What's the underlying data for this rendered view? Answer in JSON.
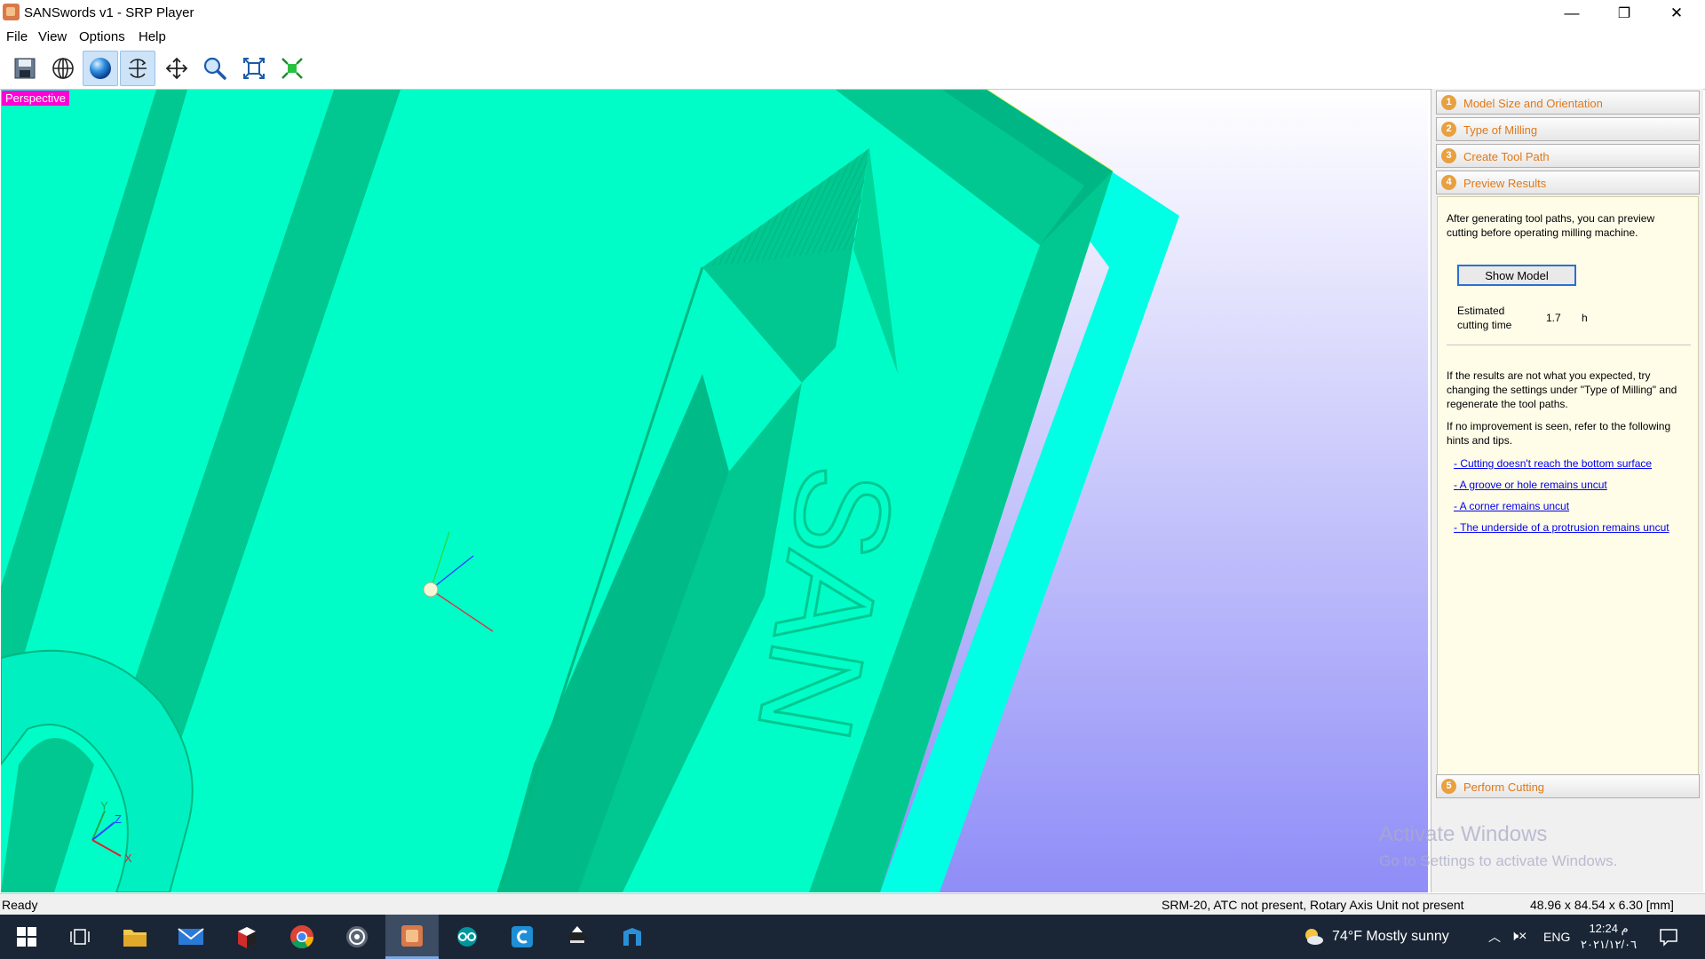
{
  "window": {
    "title": "SANSwords v1 - SRP Player",
    "minimize_glyph": "—",
    "maximize_glyph": "❐",
    "close_glyph": "✕"
  },
  "menu": [
    "File",
    "View",
    "Options",
    "Help"
  ],
  "toolbar": {
    "icons": [
      "save-icon",
      "globe-icon",
      "shaded-sphere-icon",
      "rotate-icon",
      "pan-icon",
      "zoom-icon",
      "fit-view-icon",
      "fit-all-icon"
    ],
    "active": [
      "shaded-sphere-icon",
      "rotate-icon"
    ]
  },
  "viewport": {
    "mode_label": "Perspective",
    "model_text": "SAN",
    "axes": {
      "x": "X",
      "y": "Y",
      "z": "Z"
    }
  },
  "panel": {
    "steps": [
      {
        "num": "1",
        "label": "Model Size and Orientation"
      },
      {
        "num": "2",
        "label": "Type of Milling"
      },
      {
        "num": "3",
        "label": "Create Tool Path"
      },
      {
        "num": "4",
        "label": "Preview Results"
      }
    ],
    "step5": {
      "num": "5",
      "label": "Perform Cutting"
    },
    "intro": "After generating tool paths, you can preview cutting before operating milling machine.",
    "show_model": "Show Model",
    "estimated_label": "Estimated cutting time",
    "estimated_value": "1.7",
    "estimated_unit": "h",
    "results_text": "If the results are not what you expected, try changing the settings under \"Type of Milling\" and regenerate the tool paths.",
    "improve_text": "If no improvement is seen, refer to the following hints and tips.",
    "hints": [
      "- Cutting doesn't reach the bottom surface",
      "- A groove or hole remains uncut",
      "- A corner remains uncut",
      "- The underside of a protrusion remains uncut"
    ]
  },
  "watermark": {
    "line1": "Activate Windows",
    "line2": "Go to Settings to activate Windows."
  },
  "status": {
    "left": "Ready",
    "machine": "SRM-20, ATC not present, Rotary Axis Unit not present",
    "dims": "48.96 x  84.54 x   6.30 [mm]"
  },
  "taskbar": {
    "apps": [
      "windows-start-icon",
      "task-view-icon",
      "file-explorer-icon",
      "mail-icon",
      "red-box-app-icon",
      "chrome-icon",
      "obs-icon",
      "srp-player-icon",
      "arduino-icon",
      "cura-icon",
      "inkscape-icon",
      "fusion-icon"
    ],
    "active_app": "srp-player-icon",
    "weather": "74°F  Mostly sunny",
    "lang": "ENG",
    "time": "12:24 م",
    "date": "٢٠٢١/١٢/٠٦"
  },
  "colors": {
    "model_top": "#00fdc8",
    "model_groove": "#00c890",
    "model_side": "#00ffe4",
    "bg_top": "#ffffff",
    "bg_bottom": "#8f8df7",
    "accent_orange": "#e07818",
    "taskbar": "#1a2636"
  }
}
